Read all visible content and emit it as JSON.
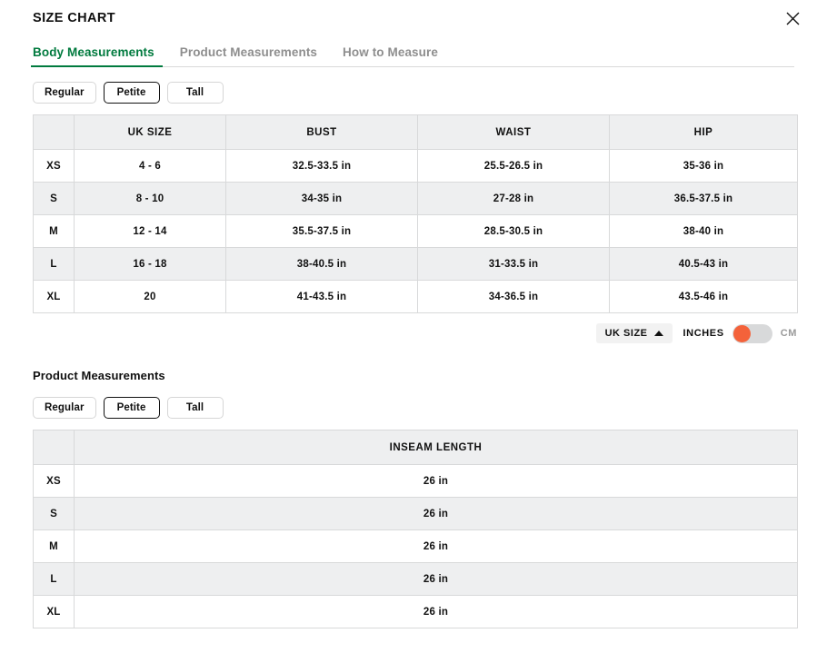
{
  "header": {
    "title": "SIZE CHART",
    "close_icon": "close-icon"
  },
  "tabs": [
    {
      "label": "Body Measurements",
      "active": true
    },
    {
      "label": "Product Measurements",
      "active": false
    },
    {
      "label": "How to Measure",
      "active": false
    }
  ],
  "body_section": {
    "fits": [
      {
        "label": "Regular",
        "selected": false
      },
      {
        "label": "Petite",
        "selected": true
      },
      {
        "label": "Tall",
        "selected": false
      }
    ],
    "table": {
      "columns": [
        "",
        "UK SIZE",
        "BUST",
        "WAIST",
        "HIP"
      ],
      "rows": [
        {
          "size": "XS",
          "uk_size": "4 - 6",
          "bust": "32.5-33.5 in",
          "waist": "25.5-26.5 in",
          "hip": "35-36 in"
        },
        {
          "size": "S",
          "uk_size": "8 - 10",
          "bust": "34-35 in",
          "waist": "27-28 in",
          "hip": "36.5-37.5 in"
        },
        {
          "size": "M",
          "uk_size": "12 - 14",
          "bust": "35.5-37.5 in",
          "waist": "28.5-30.5 in",
          "hip": "38-40 in"
        },
        {
          "size": "L",
          "uk_size": "16 - 18",
          "bust": "38-40.5 in",
          "waist": "31-33.5 in",
          "hip": "40.5-43 in"
        },
        {
          "size": "XL",
          "uk_size": "20",
          "bust": "41-43.5 in",
          "waist": "34-36.5 in",
          "hip": "43.5-46 in"
        }
      ]
    }
  },
  "controls": {
    "size_system_label": "UK SIZE",
    "size_system_caret": "caret-up-icon",
    "unit_inches_label": "INCHES",
    "unit_cm_label": "CM",
    "unit_selected": "INCHES",
    "toggle_knob_color": "#f4623a",
    "toggle_track_color": "#d8d9da"
  },
  "product_section": {
    "heading": "Product Measurements",
    "fits": [
      {
        "label": "Regular",
        "selected": false
      },
      {
        "label": "Petite",
        "selected": true
      },
      {
        "label": "Tall",
        "selected": false
      }
    ],
    "table": {
      "columns": [
        "",
        "INSEAM LENGTH"
      ],
      "rows": [
        {
          "size": "XS",
          "inseam": "26 in"
        },
        {
          "size": "S",
          "inseam": "26 in"
        },
        {
          "size": "M",
          "inseam": "26 in"
        },
        {
          "size": "L",
          "inseam": "26 in"
        },
        {
          "size": "XL",
          "inseam": "26 in"
        }
      ]
    }
  },
  "colors": {
    "accent_green": "#007a3e",
    "toggle_orange": "#f4623a",
    "row_alt": "#eeeff0",
    "border": "#d8d9da"
  }
}
